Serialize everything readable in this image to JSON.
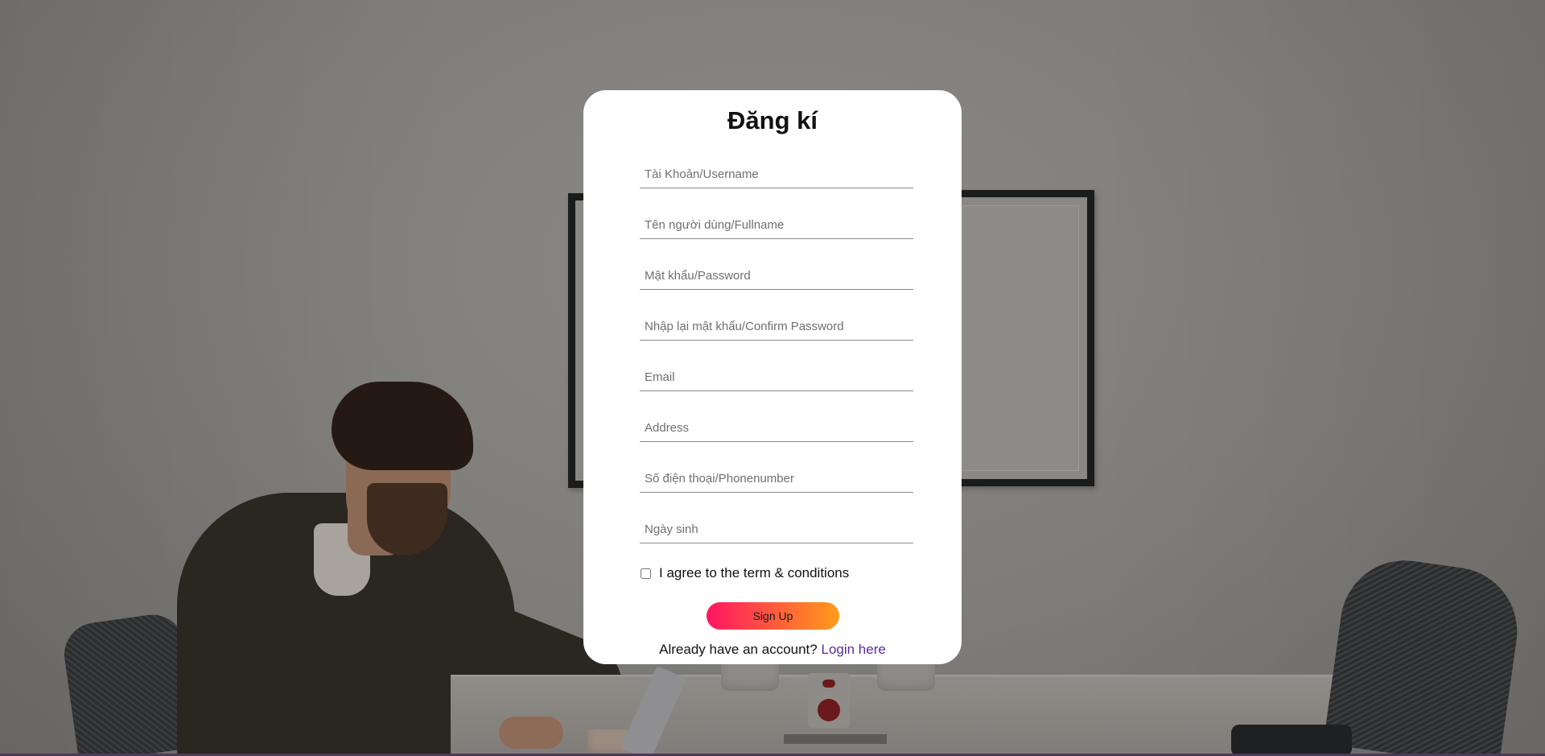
{
  "form": {
    "title": "Đăng kí",
    "fields": [
      {
        "placeholder": "Tài Khoản/Username",
        "value": ""
      },
      {
        "placeholder": "Tên người dùng/Fullname",
        "value": ""
      },
      {
        "placeholder": "Mật khẩu/Password",
        "value": ""
      },
      {
        "placeholder": "Nhập lại mật khẩu/Confirm Password",
        "value": ""
      },
      {
        "placeholder": "Email",
        "value": ""
      },
      {
        "placeholder": "Address",
        "value": ""
      },
      {
        "placeholder": "Số điện thoại/Phonenumber",
        "value": ""
      },
      {
        "placeholder": "Ngày sinh",
        "value": ""
      }
    ],
    "agree_label": "I agree to the term & conditions",
    "agree_checked": false,
    "submit_label": "Sign Up",
    "login_prompt": "Already have an account?",
    "login_link": "Login here"
  },
  "colors": {
    "accent_start": "#ff1462",
    "accent_end": "#ff9c1a",
    "link": "#5b2a9a"
  }
}
